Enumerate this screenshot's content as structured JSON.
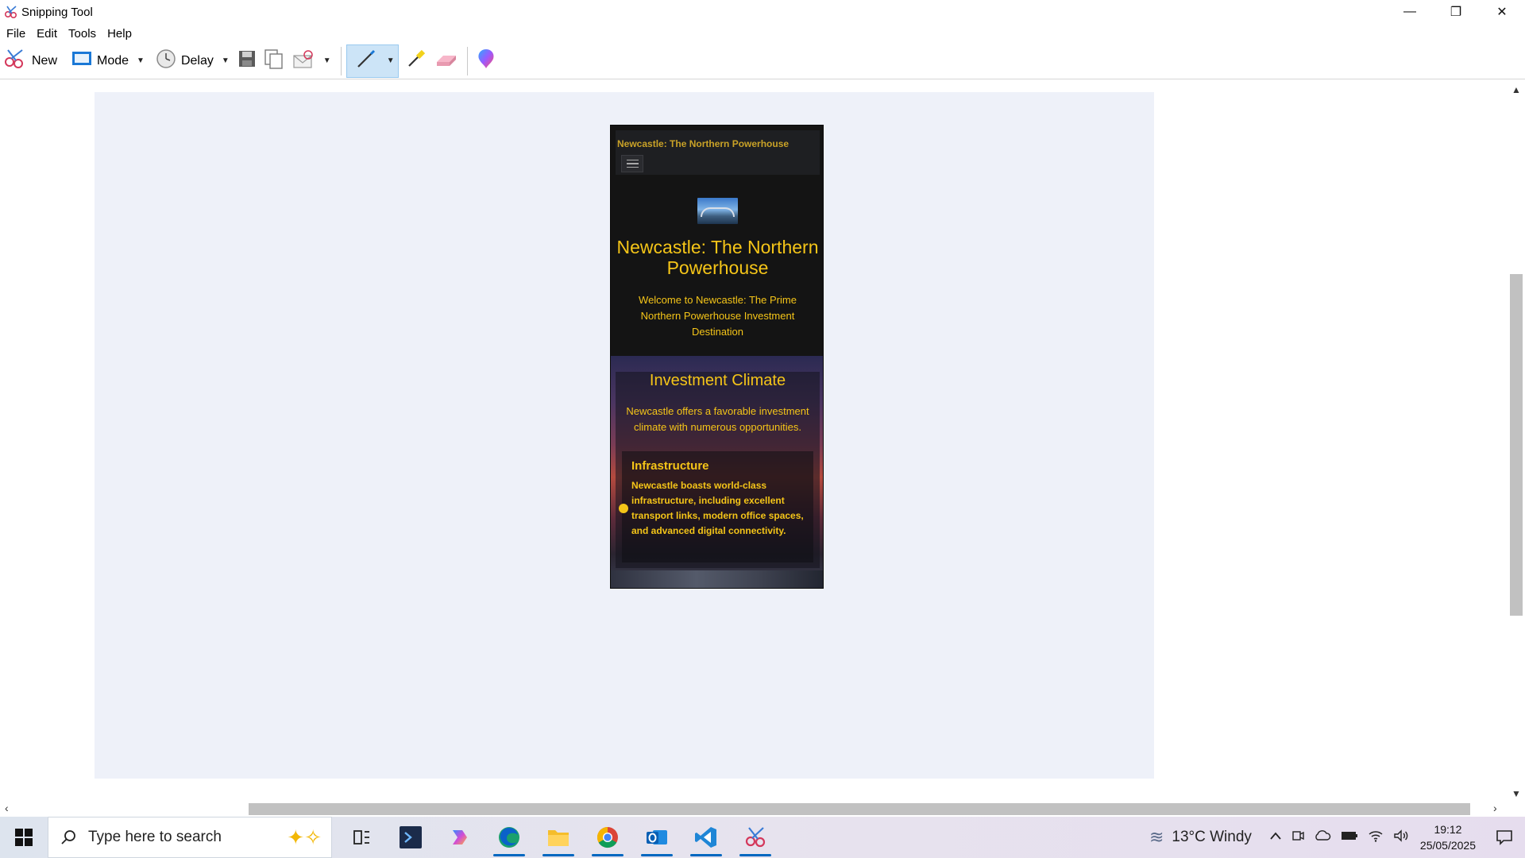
{
  "window": {
    "title": "Snipping Tool",
    "controls": {
      "minimize": "—",
      "restore": "❐",
      "close": "✕"
    }
  },
  "menubar": [
    "File",
    "Edit",
    "Tools",
    "Help"
  ],
  "toolbar": {
    "new_label": "New",
    "mode_label": "Mode",
    "delay_label": "Delay"
  },
  "capture": {
    "site_title": "Newcastle: The Northern Powerhouse",
    "hero_title": "Newcastle: The Northern Powerhouse",
    "hero_subtitle": "Welcome to Newcastle: The Prime Northern Powerhouse Investment Destination",
    "section_title": "Investment Climate",
    "section_text": "Newcastle offers a favorable investment climate with numerous opportunities.",
    "card_title": "Infrastructure",
    "card_text": "Newcastle boasts world-class infrastructure, including excellent transport links, modern office spaces, and advanced digital connectivity."
  },
  "taskbar": {
    "search_placeholder": "Type here to search",
    "weather": "13°C  Windy",
    "time": "19:12",
    "date": "25/05/2025",
    "apps": [
      "task-view",
      "powershell",
      "copilot",
      "edge",
      "file-explorer",
      "chrome",
      "outlook",
      "vscode",
      "snipping-tool"
    ]
  },
  "colors": {
    "accent_yellow": "#f5c518",
    "capture_bg": "#eef1f9",
    "selection_blue": "#cce4f7"
  }
}
